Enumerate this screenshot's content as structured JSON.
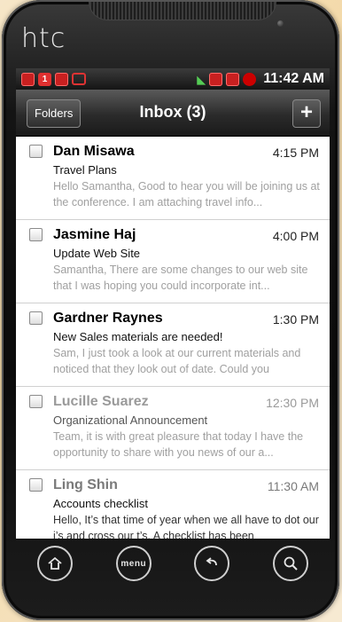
{
  "device": {
    "brand": "htc"
  },
  "status_bar": {
    "time": "11:42 AM",
    "icons": [
      "notification-red-icon",
      "notification-one-icon",
      "gmail-icon",
      "chat-bubble-icon",
      "gps-satellite-icon",
      "data-transfer-icon",
      "signal-icon",
      "battery-icon"
    ]
  },
  "header": {
    "folders_label": "Folders",
    "title": "Inbox (3)",
    "add_label": "+"
  },
  "emails": [
    {
      "sender": "Dan Misawa",
      "time": "4:15 PM",
      "subject": "Travel Plans",
      "preview": "Hello Samantha, Good to hear you will be joining us at the conference. I am attaching travel info..."
    },
    {
      "sender": "Jasmine Haj",
      "time": "4:00 PM",
      "subject": "Update Web Site",
      "preview": "Samantha, There are some changes to our web site that I was hoping you could incorporate int..."
    },
    {
      "sender": "Gardner Raynes",
      "time": "1:30 PM",
      "subject": "New Sales materials are needed!",
      "preview": "Sam, I just took a look at our current materials and noticed that they look out of date. Could you"
    },
    {
      "sender": "Lucille Suarez",
      "time": "12:30 PM",
      "subject": "Organizational Announcement",
      "preview": "Team, it is with great pleasure that today I have the opportunity to share with you news of our a..."
    },
    {
      "sender": "Ling Shin",
      "time": "11:30 AM",
      "subject": "Accounts checklist",
      "preview": "Hello, It’s that time of year when we all have to dot our i’s and cross our t’s. A checklist has been"
    }
  ],
  "nav_buttons": {
    "menu_label": "menu"
  }
}
